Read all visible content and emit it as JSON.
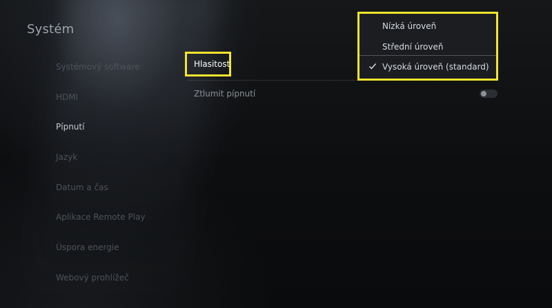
{
  "section": {
    "title": "Systém"
  },
  "sidebar": {
    "items": [
      {
        "label": "Systémový software",
        "active": false
      },
      {
        "label": "HDMI",
        "active": false
      },
      {
        "label": "Pípnutí",
        "active": true
      },
      {
        "label": "Jazyk",
        "active": false
      },
      {
        "label": "Datum a čas",
        "active": false
      },
      {
        "label": "Aplikace Remote Play",
        "active": false
      },
      {
        "label": "Úspora energie",
        "active": false
      },
      {
        "label": "Webový prohlížeč",
        "active": false
      }
    ]
  },
  "content": {
    "volume_label": "Hlasitost",
    "mute_label": "Ztlumit pípnutí",
    "mute_enabled": false
  },
  "dropdown": {
    "options": [
      {
        "label": "Nízká úroveň",
        "selected": false
      },
      {
        "label": "Střední úroveň",
        "selected": false
      },
      {
        "label": "Vysoká úroveň (standard)",
        "selected": true
      }
    ],
    "check_icon": "checkmark-icon"
  },
  "colors": {
    "highlight": "#f4e62d",
    "background": "#0c0d0f",
    "active_text": "#c7ccd2",
    "inactive_text": "#4d535b"
  }
}
